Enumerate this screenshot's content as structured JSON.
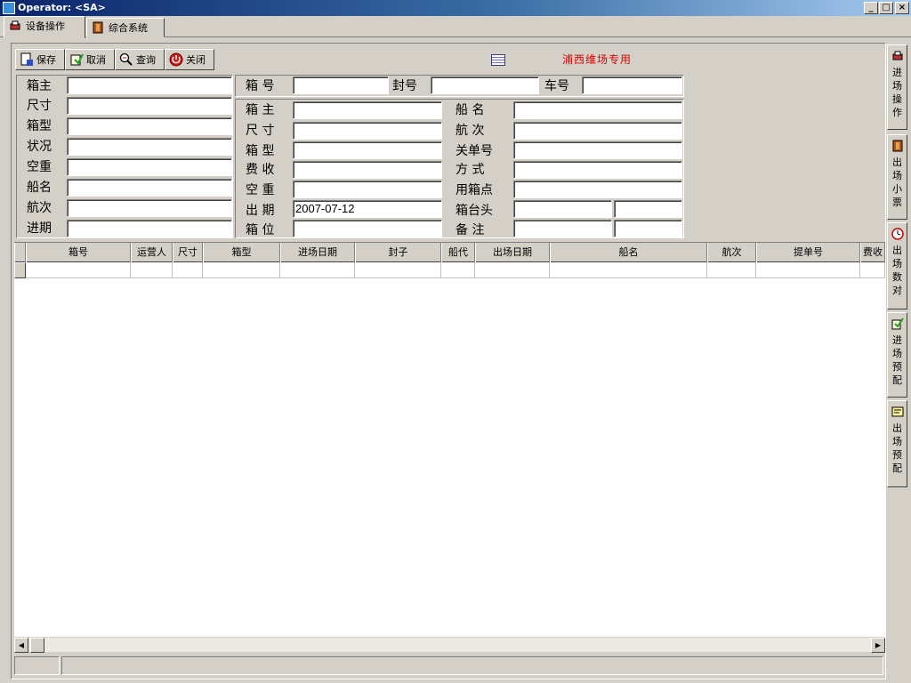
{
  "window": {
    "title": "Operator: <SA>",
    "buttons": {
      "minimize": "_",
      "maximize": "□",
      "close": "×"
    }
  },
  "tabs": [
    {
      "label": "设备操作",
      "icon": "red-device-icon"
    },
    {
      "label": "综合系统",
      "icon": "book-icon"
    }
  ],
  "toolbar": {
    "save": "保存",
    "cancel": "取消",
    "query": "查询",
    "close": "关闭"
  },
  "banner": "浦西维场专用",
  "left_form": {
    "labels": [
      "箱主",
      "尺寸",
      "箱型",
      "状况",
      "空重",
      "船名",
      "航次",
      "进期"
    ],
    "values": [
      "",
      "",
      "",
      "",
      "",
      "",
      "",
      ""
    ]
  },
  "top_row": {
    "box_no": {
      "label": "箱 号",
      "value": ""
    },
    "seal_no": {
      "label": "封号",
      "value": ""
    },
    "truck_no": {
      "label": "车号",
      "value": ""
    }
  },
  "mid_form": {
    "labels": [
      "箱 主",
      "尺 寸",
      "箱 型",
      "费 收",
      "空 重",
      "出 期",
      "箱 位"
    ],
    "values": [
      "",
      "",
      "",
      "",
      "",
      "2007-07-12",
      ""
    ]
  },
  "right_form": {
    "labels": [
      "船 名",
      "航 次",
      "关单号",
      "方 式",
      "用箱点",
      "箱台头",
      "备 注"
    ],
    "values": [
      "",
      "",
      "",
      "",
      "",
      "",
      ""
    ]
  },
  "grid": {
    "columns": [
      "箱号",
      "运营人",
      "尺寸",
      "箱型",
      "进场日期",
      "封子",
      "船代",
      "出场日期",
      "船名",
      "航次",
      "提单号",
      "费收"
    ]
  },
  "side_tabs": [
    {
      "label": "进场操作",
      "icon": "red-device-icon"
    },
    {
      "label": "出场小票",
      "icon": "book-icon"
    },
    {
      "label": "出场数对",
      "icon": "clock-icon"
    },
    {
      "label": "进场预配",
      "icon": "edit-icon"
    },
    {
      "label": "出场预配",
      "icon": "note-icon"
    }
  ]
}
